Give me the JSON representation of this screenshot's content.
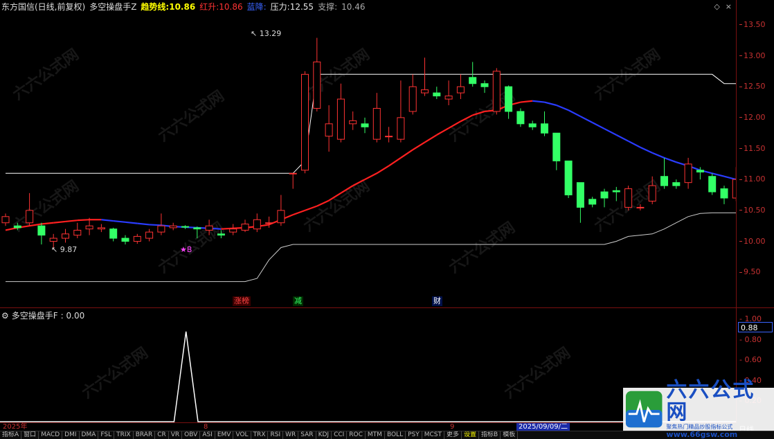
{
  "header": {
    "stock_label": "东方国信(日线,前复权)",
    "indicator_name": "多空操盘手Z",
    "trend_label": "趋势线:",
    "trend_value": "10.86",
    "red_label": "红升:",
    "red_value": "10.86",
    "blue_label": "蓝降:",
    "pressure_label": "压力:",
    "pressure_value": "12.55",
    "support_label": "支撑:",
    "support_value": "10.46"
  },
  "controls": {
    "diamond_icon": "◇",
    "close_icon": "×"
  },
  "price_axis": {
    "ticks": [
      "13.50",
      "13.00",
      "12.50",
      "12.00",
      "11.50",
      "11.00",
      "10.50",
      "10.00",
      "9.50"
    ]
  },
  "sub_header": {
    "indicator_name": "多空操盘手F",
    "value": ": 0.00"
  },
  "sub_axis": {
    "ticks": [
      "1.00",
      "0.80",
      "0.60",
      "0.40",
      "0.20"
    ],
    "last_value": "0.88"
  },
  "annotations": {
    "high": "13.29",
    "low": "9.87",
    "buy_marker": "★B"
  },
  "events": {
    "e1": "涨榜",
    "e2": "减",
    "e3": "财"
  },
  "date_bar": {
    "d1": "2025年",
    "d2": "8",
    "d3": "9",
    "cursor": "2025/09/09/二"
  },
  "period_label": "日线",
  "tabs": [
    "指标A",
    "窗口",
    "MACD",
    "DMI",
    "DMA",
    "FSL",
    "TRIX",
    "BRAR",
    "CR",
    "VR",
    "OBV",
    "ASI",
    "EMV",
    "VOL",
    "TRX",
    "RSI",
    "WR",
    "SAR",
    "KDJ",
    "CCI",
    "ROC",
    "MTM",
    "BOLL",
    "PSY",
    "MCST",
    "更多",
    "设置",
    "指标B",
    "模板"
  ],
  "brand": {
    "title": "六六公式网",
    "slogan": "聚焦热门精品炒股指标公式",
    "url": "www.66gsw.com"
  },
  "watermarks": [
    "六六公式网",
    "六六公式网",
    "六六公式网",
    "六六公式网",
    "六六公式网",
    "六六公式网",
    "六六公式网",
    "六六公式网",
    "六六公式网",
    "六六公式网",
    "六六公式网",
    "六六公式网"
  ],
  "chart_data": {
    "type": "candlestick",
    "ylim": [
      9.2,
      13.7
    ],
    "candles": [
      {
        "o": 10.3,
        "c": 10.4,
        "h": 10.45,
        "l": 10.25
      },
      {
        "o": 10.25,
        "c": 10.22,
        "h": 10.3,
        "l": 10.18
      },
      {
        "o": 10.3,
        "c": 10.5,
        "h": 10.78,
        "l": 10.25
      },
      {
        "o": 10.25,
        "c": 10.1,
        "h": 10.3,
        "l": 9.95
      },
      {
        "o": 10.0,
        "c": 10.05,
        "h": 10.12,
        "l": 9.87
      },
      {
        "o": 10.05,
        "c": 10.12,
        "h": 10.2,
        "l": 9.98
      },
      {
        "o": 10.1,
        "c": 10.18,
        "h": 10.3,
        "l": 10.05
      },
      {
        "o": 10.2,
        "c": 10.25,
        "h": 10.38,
        "l": 10.1
      },
      {
        "o": 10.2,
        "c": 10.22,
        "h": 10.28,
        "l": 10.15
      },
      {
        "o": 10.2,
        "c": 10.05,
        "h": 10.22,
        "l": 10.0
      },
      {
        "o": 10.05,
        "c": 10.0,
        "h": 10.1,
        "l": 9.95
      },
      {
        "o": 10.0,
        "c": 10.08,
        "h": 10.12,
        "l": 9.96
      },
      {
        "o": 10.05,
        "c": 10.15,
        "h": 10.2,
        "l": 10.0
      },
      {
        "o": 10.15,
        "c": 10.25,
        "h": 10.45,
        "l": 10.1
      },
      {
        "o": 10.22,
        "c": 10.25,
        "h": 10.3,
        "l": 10.18
      },
      {
        "o": 10.24,
        "c": 10.23,
        "h": 10.26,
        "l": 10.2
      },
      {
        "o": 10.22,
        "c": 10.2,
        "h": 10.24,
        "l": 10.05
      },
      {
        "o": 10.18,
        "c": 10.25,
        "h": 10.35,
        "l": 10.1
      },
      {
        "o": 10.12,
        "c": 10.1,
        "h": 10.18,
        "l": 10.05
      },
      {
        "o": 10.15,
        "c": 10.2,
        "h": 10.28,
        "l": 10.1
      },
      {
        "o": 10.18,
        "c": 10.28,
        "h": 10.35,
        "l": 10.15
      },
      {
        "o": 10.2,
        "c": 10.35,
        "h": 10.45,
        "l": 10.15
      },
      {
        "o": 10.3,
        "c": 10.3,
        "h": 10.4,
        "l": 10.22
      },
      {
        "o": 10.3,
        "c": 10.5,
        "h": 10.75,
        "l": 10.25
      },
      {
        "o": 11.1,
        "c": 11.1,
        "h": 11.1,
        "l": 10.85
      },
      {
        "o": 11.15,
        "c": 12.7,
        "h": 12.75,
        "l": 11.1
      },
      {
        "o": 12.15,
        "c": 12.9,
        "h": 13.29,
        "l": 12.1
      },
      {
        "o": 11.7,
        "c": 11.9,
        "h": 12.2,
        "l": 11.45
      },
      {
        "o": 11.65,
        "c": 12.3,
        "h": 12.55,
        "l": 11.6
      },
      {
        "o": 11.9,
        "c": 11.95,
        "h": 12.1,
        "l": 11.8
      },
      {
        "o": 11.9,
        "c": 11.85,
        "h": 12.0,
        "l": 11.75
      },
      {
        "o": 11.65,
        "c": 12.15,
        "h": 12.4,
        "l": 11.6
      },
      {
        "o": 11.7,
        "c": 11.7,
        "h": 11.85,
        "l": 11.6
      },
      {
        "o": 11.65,
        "c": 12.0,
        "h": 12.6,
        "l": 11.6
      },
      {
        "o": 12.1,
        "c": 12.5,
        "h": 12.7,
        "l": 12.05
      },
      {
        "o": 12.4,
        "c": 12.45,
        "h": 12.97,
        "l": 12.35
      },
      {
        "o": 12.4,
        "c": 12.35,
        "h": 12.5,
        "l": 12.3
      },
      {
        "o": 12.3,
        "c": 12.35,
        "h": 12.6,
        "l": 12.2
      },
      {
        "o": 12.4,
        "c": 12.5,
        "h": 12.7,
        "l": 12.3
      },
      {
        "o": 12.65,
        "c": 12.55,
        "h": 12.9,
        "l": 12.5
      },
      {
        "o": 12.55,
        "c": 12.5,
        "h": 12.6,
        "l": 12.4
      },
      {
        "o": 12.1,
        "c": 12.75,
        "h": 12.8,
        "l": 12.05
      },
      {
        "o": 12.5,
        "c": 12.1,
        "h": 12.52,
        "l": 11.98
      },
      {
        "o": 12.1,
        "c": 11.9,
        "h": 12.15,
        "l": 11.85
      },
      {
        "o": 11.9,
        "c": 11.85,
        "h": 11.95,
        "l": 11.8
      },
      {
        "o": 11.9,
        "c": 11.75,
        "h": 12.1,
        "l": 11.7
      },
      {
        "o": 11.75,
        "c": 11.3,
        "h": 11.75,
        "l": 11.15
      },
      {
        "o": 11.3,
        "c": 10.75,
        "h": 11.3,
        "l": 10.7
      },
      {
        "o": 10.95,
        "c": 10.55,
        "h": 10.95,
        "l": 10.3
      },
      {
        "o": 10.68,
        "c": 10.6,
        "h": 10.72,
        "l": 10.55
      },
      {
        "o": 10.8,
        "c": 10.7,
        "h": 10.85,
        "l": 10.55
      },
      {
        "o": 10.82,
        "c": 10.8,
        "h": 10.88,
        "l": 10.65
      },
      {
        "o": 10.55,
        "c": 10.85,
        "h": 10.9,
        "l": 10.5
      },
      {
        "o": 10.55,
        "c": 10.55,
        "h": 10.6,
        "l": 10.5
      },
      {
        "o": 10.65,
        "c": 10.9,
        "h": 11.05,
        "l": 10.6
      },
      {
        "o": 11.05,
        "c": 10.9,
        "h": 11.35,
        "l": 10.85
      },
      {
        "o": 10.95,
        "c": 10.9,
        "h": 11.0,
        "l": 10.85
      },
      {
        "o": 10.95,
        "c": 11.25,
        "h": 11.35,
        "l": 10.85
      },
      {
        "o": 11.15,
        "c": 11.12,
        "h": 11.2,
        "l": 11.0
      },
      {
        "o": 11.05,
        "c": 10.8,
        "h": 11.1,
        "l": 10.75
      },
      {
        "o": 10.85,
        "c": 10.7,
        "h": 10.9,
        "l": 10.6
      },
      {
        "o": 10.7,
        "c": 11.0,
        "h": 11.2,
        "l": 10.65
      },
      {
        "o": 10.7,
        "c": 11.05,
        "h": 11.1,
        "l": 10.4
      },
      {
        "o": 10.7,
        "c": 11.1,
        "h": 11.15,
        "l": 10.55
      },
      {
        "o": 11.12,
        "c": 11.15,
        "h": 11.28,
        "l": 11.0
      },
      {
        "o": 11.08,
        "c": 10.7,
        "h": 11.08,
        "l": 10.6
      },
      {
        "o": 10.8,
        "c": 10.88,
        "h": 10.95,
        "l": 10.6
      },
      {
        "o": 10.86,
        "c": 10.89,
        "h": 11.08,
        "l": 10.84
      }
    ],
    "trend_line": [
      10.18,
      10.22,
      10.25,
      10.28,
      10.3,
      10.32,
      10.34,
      10.35,
      10.35,
      10.33,
      10.31,
      10.29,
      10.27,
      10.26,
      10.24,
      10.23,
      10.22,
      10.21,
      10.2,
      10.21,
      10.22,
      10.24,
      10.27,
      10.35,
      10.43,
      10.5,
      10.57,
      10.66,
      10.78,
      10.9,
      11.0,
      11.1,
      11.22,
      11.35,
      11.48,
      11.6,
      11.72,
      11.83,
      11.94,
      12.04,
      12.1,
      12.12,
      12.2,
      12.25,
      12.27,
      12.25,
      12.2,
      12.12,
      12.02,
      11.92,
      11.82,
      11.72,
      11.62,
      11.52,
      11.43,
      11.35,
      11.28,
      11.22,
      11.15,
      11.1,
      11.05,
      11.0,
      10.96,
      10.92,
      10.9,
      10.88,
      10.87,
      10.86
    ],
    "pressure_line": [
      11.1,
      11.1,
      11.1,
      11.1,
      11.1,
      11.1,
      11.1,
      11.1,
      11.1,
      11.1,
      11.1,
      11.1,
      11.1,
      11.1,
      11.1,
      11.1,
      11.1,
      11.1,
      11.1,
      11.1,
      11.1,
      11.1,
      11.1,
      11.1,
      11.1,
      11.3,
      12.7,
      12.7,
      12.7,
      12.7,
      12.7,
      12.7,
      12.7,
      12.7,
      12.7,
      12.7,
      12.7,
      12.7,
      12.7,
      12.7,
      12.7,
      12.7,
      12.7,
      12.7,
      12.7,
      12.7,
      12.7,
      12.7,
      12.7,
      12.7,
      12.7,
      12.7,
      12.7,
      12.7,
      12.7,
      12.7,
      12.7,
      12.7,
      12.7,
      12.7,
      12.55,
      12.55,
      12.55,
      12.55,
      12.55,
      12.55,
      12.55,
      12.55
    ],
    "support_line": [
      9.35,
      9.35,
      9.35,
      9.35,
      9.35,
      9.35,
      9.35,
      9.35,
      9.35,
      9.35,
      9.35,
      9.35,
      9.35,
      9.35,
      9.35,
      9.35,
      9.35,
      9.35,
      9.35,
      9.35,
      9.35,
      9.4,
      9.7,
      9.9,
      9.95,
      9.95,
      9.95,
      9.95,
      9.95,
      9.95,
      9.95,
      9.95,
      9.95,
      9.95,
      9.95,
      9.95,
      9.95,
      9.95,
      9.95,
      9.95,
      9.95,
      9.95,
      9.95,
      9.95,
      9.95,
      9.95,
      9.95,
      9.95,
      9.95,
      9.95,
      9.95,
      10.0,
      10.08,
      10.1,
      10.12,
      10.2,
      10.3,
      10.4,
      10.45,
      10.46,
      10.46,
      10.46,
      10.46,
      10.46,
      10.46,
      10.46,
      10.46,
      10.46
    ],
    "sub_series": [
      0,
      0,
      0,
      0,
      0,
      0,
      0,
      0,
      0,
      0,
      0,
      0,
      0,
      0,
      0,
      0,
      0,
      0,
      0,
      0.88,
      0,
      0,
      0,
      0,
      0,
      0,
      0,
      0,
      0,
      0,
      0,
      0,
      0,
      0,
      0,
      0,
      0,
      0,
      0,
      0,
      0,
      0,
      0,
      0,
      0,
      0,
      0,
      0,
      0,
      0,
      0,
      0,
      0,
      0,
      0,
      0,
      0,
      0,
      0,
      0,
      0,
      0,
      0,
      0,
      0,
      0,
      0,
      0
    ],
    "sub_ylim": [
      0,
      1.0
    ],
    "colors": {
      "up": "#ff3333",
      "down": "#33ff66",
      "trend_up": "#ff2020",
      "trend_down": "#2a3cff",
      "pressure": "#ffffff",
      "support": "#cccccc",
      "sub": "#ffffff"
    }
  }
}
